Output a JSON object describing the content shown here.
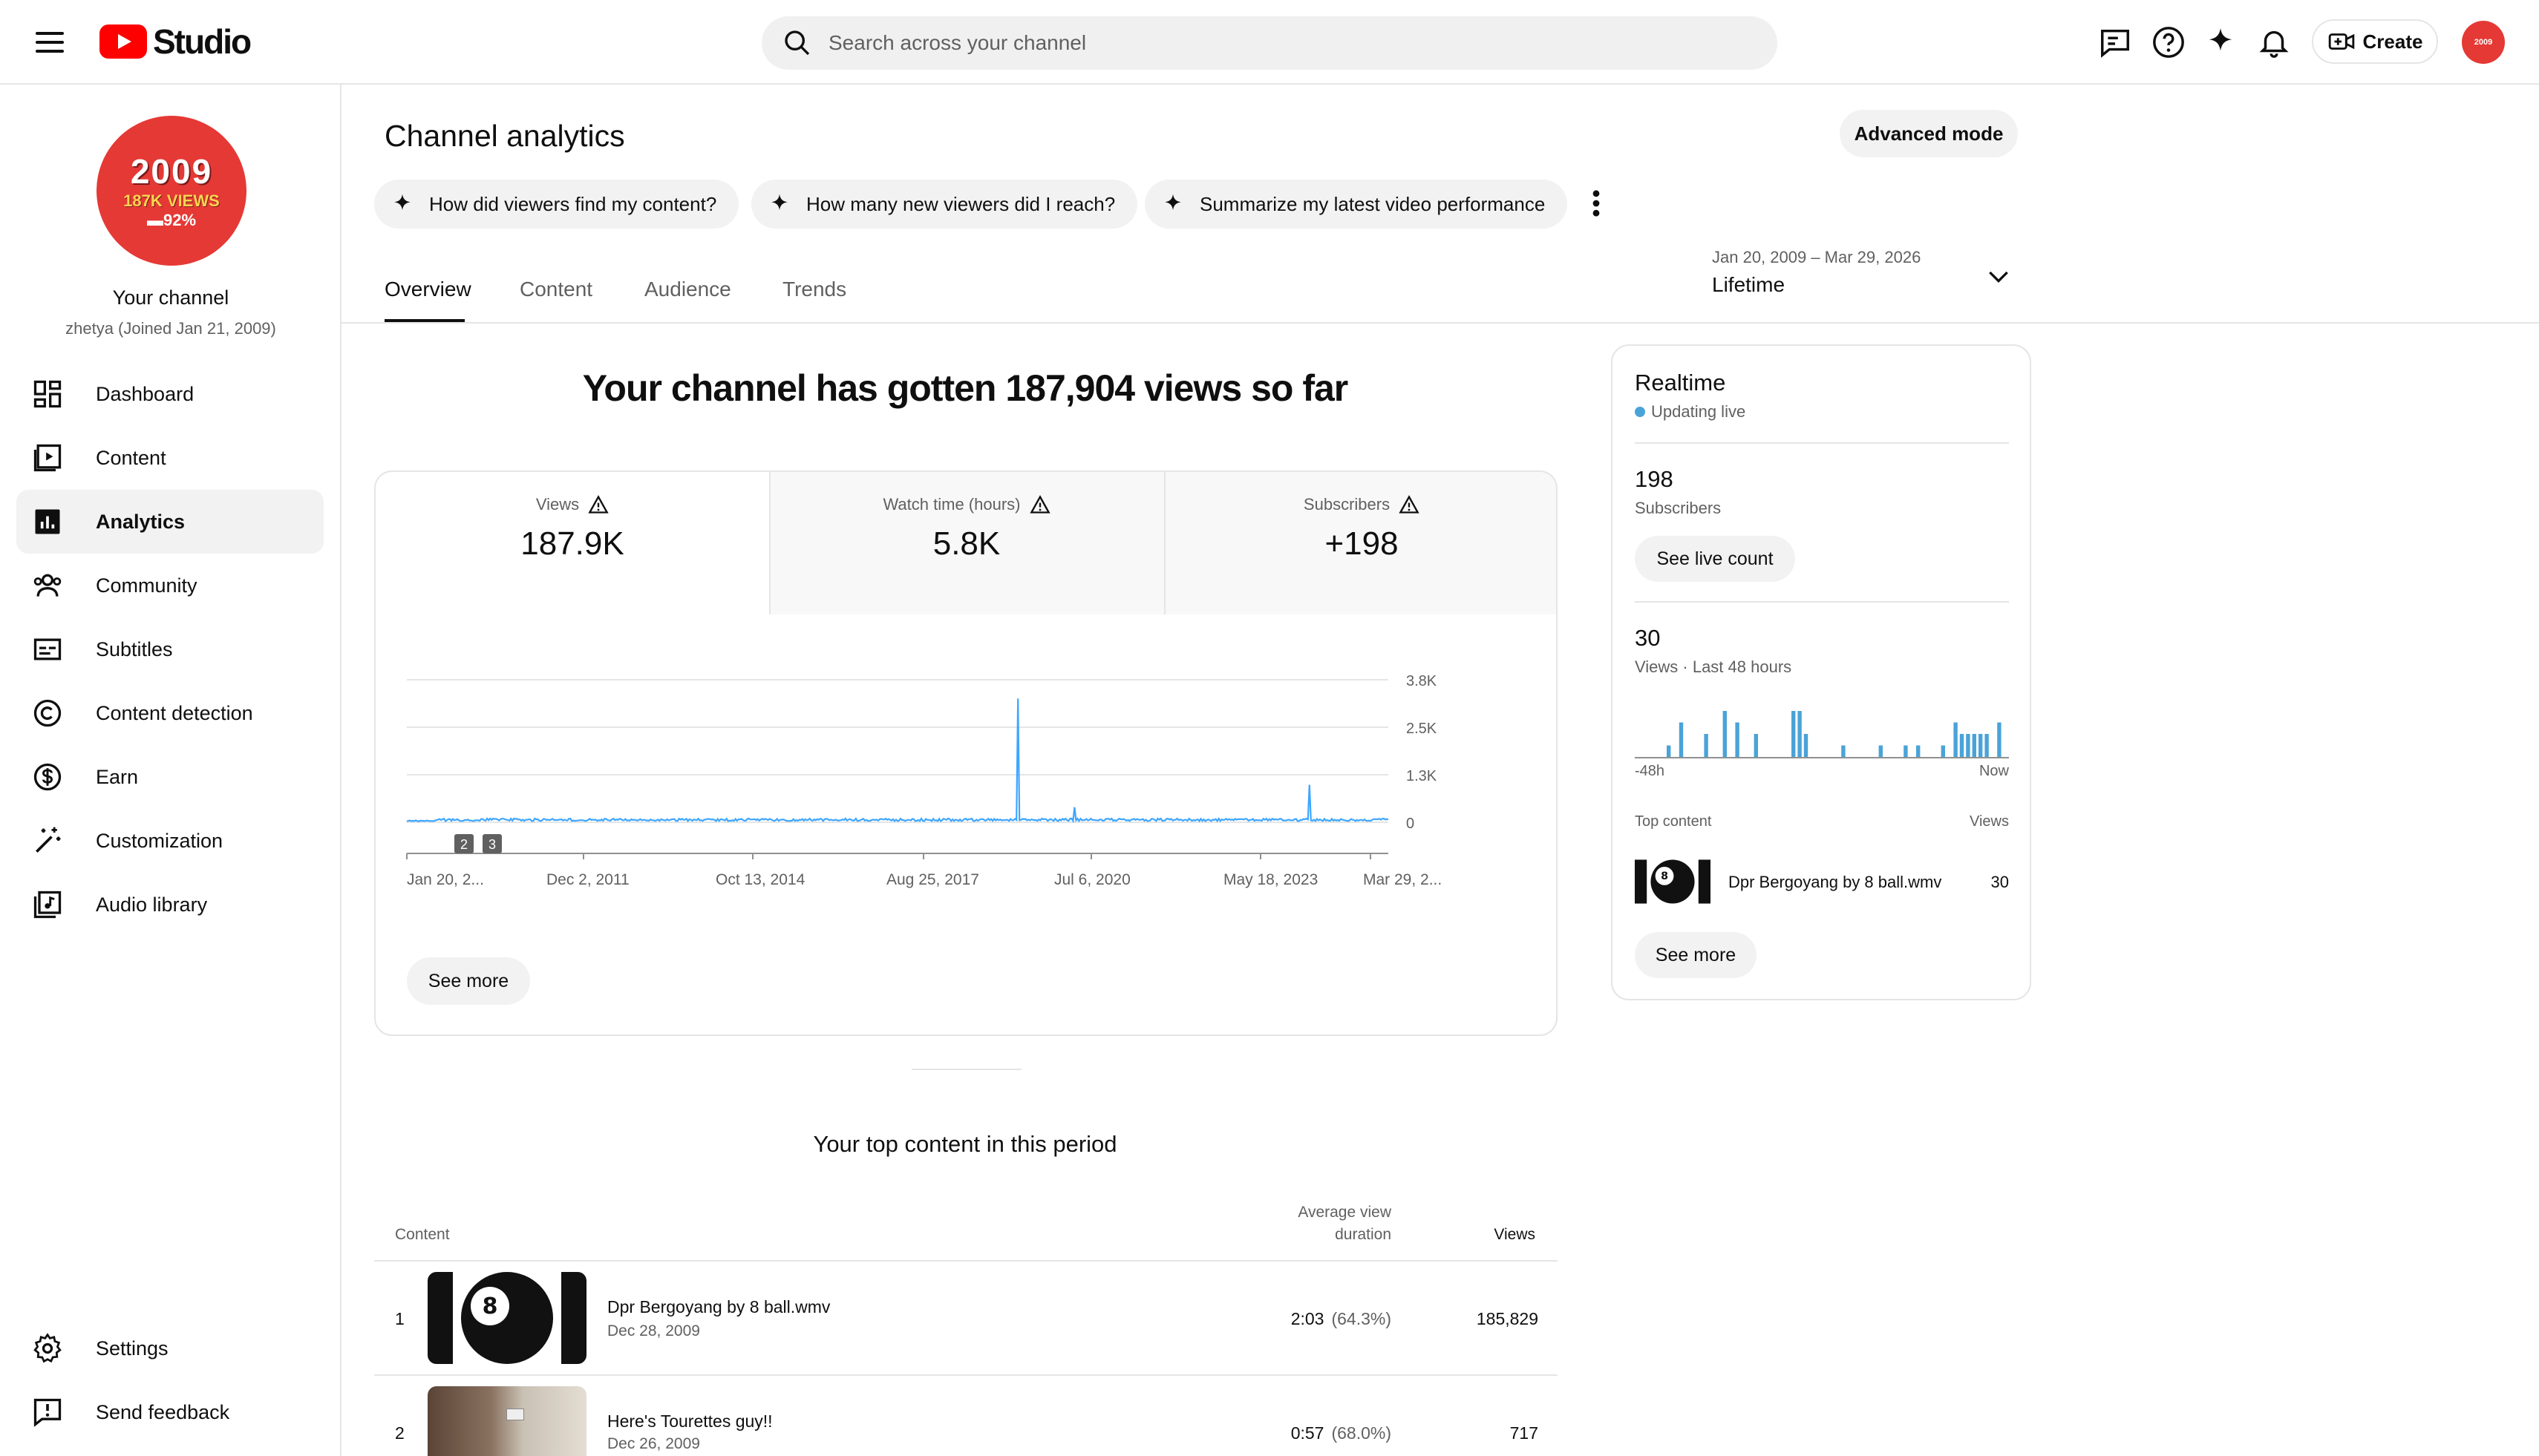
{
  "header": {
    "logo_text": "Studio",
    "search_placeholder": "Search across your channel",
    "create_label": "Create",
    "avatar_text": "2009"
  },
  "sidebar": {
    "channel_avatar": {
      "year": "2009",
      "views": "187K VIEWS",
      "pct": "▬92%"
    },
    "channel_title": "Your channel",
    "channel_sub": "zhetya (Joined Jan 21, 2009)",
    "items": [
      {
        "label": "Dashboard",
        "icon": "dashboard-icon"
      },
      {
        "label": "Content",
        "icon": "content-icon"
      },
      {
        "label": "Analytics",
        "icon": "analytics-icon",
        "active": true
      },
      {
        "label": "Community",
        "icon": "community-icon"
      },
      {
        "label": "Subtitles",
        "icon": "subtitles-icon"
      },
      {
        "label": "Content detection",
        "icon": "copyright-icon"
      },
      {
        "label": "Earn",
        "icon": "dollar-icon"
      },
      {
        "label": "Customization",
        "icon": "magic-wand-icon"
      },
      {
        "label": "Audio library",
        "icon": "audio-library-icon"
      }
    ],
    "bottom_items": [
      {
        "label": "Settings",
        "icon": "gear-icon"
      },
      {
        "label": "Send feedback",
        "icon": "feedback-icon"
      }
    ]
  },
  "main": {
    "title": "Channel analytics",
    "advanced_mode_label": "Advanced mode",
    "chips": [
      "How did viewers find my content?",
      "How many new viewers did I reach?",
      "Summarize my latest video performance"
    ],
    "tabs": [
      "Overview",
      "Content",
      "Audience",
      "Trends"
    ],
    "date_range": "Jan 20, 2009 – Mar 29, 2026",
    "date_period": "Lifetime",
    "headline": "Your channel has gotten 187,904 views so far",
    "metrics": [
      {
        "label": "Views",
        "value": "187.9K"
      },
      {
        "label": "Watch time (hours)",
        "value": "5.8K"
      },
      {
        "label": "Subscribers",
        "value": "+198"
      }
    ],
    "see_more_label": "See more",
    "top_content_title": "Your top content in this period",
    "table_headers": {
      "content": "Content",
      "avg_line1": "Average view",
      "avg_line2": "duration",
      "views": "Views"
    },
    "rows": [
      {
        "num": "1",
        "title": "Dpr Bergoyang by 8 ball.wmv",
        "date": "Dec 28, 2009",
        "avg": "2:03",
        "pct": "(64.3%)",
        "views": "185,829"
      },
      {
        "num": "2",
        "title": "Here's Tourettes guy!!",
        "date": "Dec 26, 2009",
        "avg": "0:57",
        "pct": "(68.0%)",
        "views": "717"
      }
    ]
  },
  "chart_data": {
    "type": "line",
    "series": [
      {
        "values": "daily views, lifetime"
      }
    ],
    "x_tick_labels": [
      "Jan 20, 2...",
      "Dec 2, 2011",
      "Oct 13, 2014",
      "Aug 25, 2017",
      "Jul 6, 2020",
      "May 18, 2023",
      "Mar 29, 2..."
    ],
    "y_tick_labels": [
      "3.8K",
      "2.5K",
      "1.3K",
      "0"
    ],
    "ylim": [
      0,
      3800
    ],
    "spikes": [
      {
        "x_fraction": 0.623,
        "value": 3300
      },
      {
        "x_fraction": 0.68,
        "value": 400
      },
      {
        "x_fraction": 0.92,
        "value": 1000
      }
    ],
    "baseline_value": 50,
    "markers": [
      "2",
      "3"
    ],
    "grid": true
  },
  "realtime": {
    "title": "Realtime",
    "status": "Updating live",
    "subscribers_value": "198",
    "subscribers_label": "Subscribers",
    "live_count_label": "See live count",
    "views_value": "30",
    "views_label": "Views · Last 48 hours",
    "bar_values": [
      0,
      0,
      0,
      0,
      0,
      1,
      0,
      3,
      0,
      0,
      0,
      2,
      0,
      0,
      4,
      0,
      3,
      0,
      0,
      2,
      0,
      0,
      0,
      0,
      0,
      4,
      4,
      2,
      0,
      0,
      0,
      0,
      0,
      1,
      0,
      0,
      0,
      0,
      0,
      1,
      0,
      0,
      0,
      1,
      0,
      1,
      0,
      0,
      0,
      1,
      0,
      3,
      2,
      2,
      2,
      2,
      2,
      0,
      3,
      0
    ],
    "axis_start": "-48h",
    "axis_end": "Now",
    "top_content_label": "Top content",
    "top_content_views_label": "Views",
    "top_item_title": "Dpr Bergoyang by 8 ball.wmv",
    "top_item_views": "30",
    "see_more_label": "See more"
  }
}
